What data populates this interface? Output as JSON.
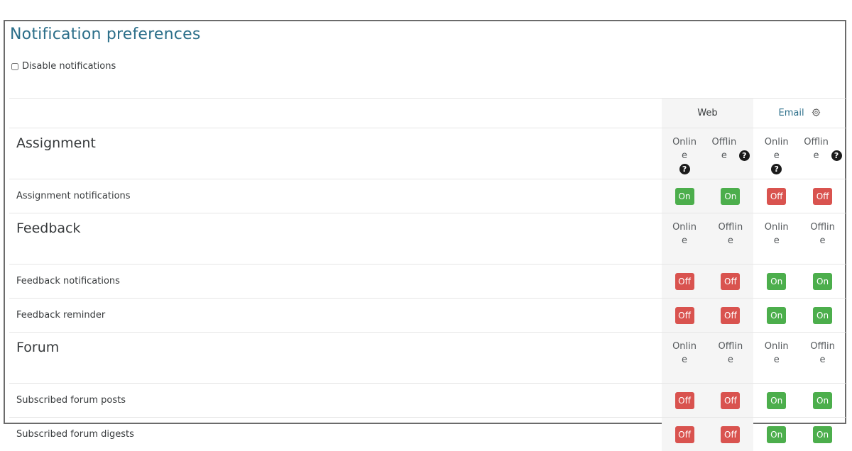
{
  "page": {
    "title": "Notification preferences",
    "disable_notifications": {
      "label": "Disable notifications",
      "checked": false
    }
  },
  "columns": {
    "processors": [
      {
        "name": "Web",
        "has_settings": false
      },
      {
        "name": "Email",
        "has_settings": true,
        "settings_icon": "gear-icon"
      }
    ],
    "states": [
      "Online",
      "Offline"
    ],
    "help_icon": "question-circle-icon"
  },
  "toggle_labels": {
    "on": "On",
    "off": "Off"
  },
  "colors": {
    "on": "#4cae4c",
    "off": "#d9534f",
    "title": "#2c6f8a"
  },
  "groups": [
    {
      "name": "Assignment",
      "show_help": true,
      "items": [
        {
          "name": "Assignment notifications",
          "values": [
            "On",
            "On",
            "Off",
            "Off"
          ]
        }
      ]
    },
    {
      "name": "Feedback",
      "show_help": false,
      "items": [
        {
          "name": "Feedback notifications",
          "values": [
            "Off",
            "Off",
            "On",
            "On"
          ]
        },
        {
          "name": "Feedback reminder",
          "values": [
            "Off",
            "Off",
            "On",
            "On"
          ]
        }
      ]
    },
    {
      "name": "Forum",
      "show_help": false,
      "items": [
        {
          "name": "Subscribed forum posts",
          "values": [
            "Off",
            "Off",
            "On",
            "On"
          ]
        },
        {
          "name": "Subscribed forum digests",
          "values": [
            "Off",
            "Off",
            "On",
            "On"
          ]
        }
      ]
    }
  ]
}
